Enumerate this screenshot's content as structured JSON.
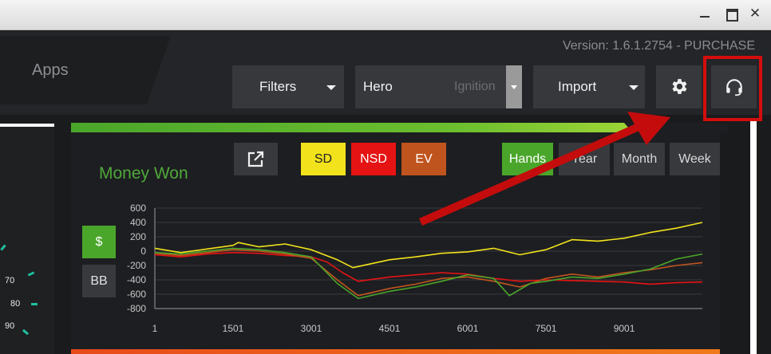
{
  "window": {
    "minimize_label": "",
    "maximize_label": "",
    "close_label": "✕"
  },
  "header": {
    "apps_tab": "Apps",
    "version": "Version: 1.6.1.2754 - PURCHASE",
    "filters_label": "Filters",
    "hero_label": "Hero",
    "hero_site": "Ignition",
    "import_label": "Import",
    "settings_icon": "gear-icon",
    "support_icon": "headset-icon"
  },
  "gauge": {
    "labels": [
      "70",
      "80",
      "90"
    ]
  },
  "panel": {
    "title": "Money Won",
    "share_icon": "external-link-icon",
    "sd_label": "SD",
    "nsd_label": "NSD",
    "ev_label": "EV",
    "hands_label": "Hands",
    "year_label": "Year",
    "month_label": "Month",
    "week_label": "Week",
    "dollar_label": "$",
    "bb_label": "BB"
  },
  "colors": {
    "accent_green": "#4aa62a",
    "sd_yellow": "#f2e21b",
    "nsd_red": "#e51313",
    "ev_orange": "#c0541e",
    "highlight_red": "#d40d0d"
  },
  "chart_data": {
    "type": "line",
    "title": "Money Won",
    "xlabel": "",
    "ylabel": "",
    "xlim": [
      1,
      10500
    ],
    "ylim": [
      -800,
      600
    ],
    "yticks": [
      "600",
      "400",
      "200",
      "0",
      "-200",
      "-400",
      "-600",
      "-800"
    ],
    "xticks": [
      "1",
      "1501",
      "3001",
      "4501",
      "6001",
      "7501",
      "9001"
    ],
    "xtick_values": [
      1,
      1501,
      3001,
      4501,
      6001,
      7501,
      9001
    ],
    "ytick_values": [
      600,
      400,
      200,
      0,
      -200,
      -400,
      -600,
      -800
    ],
    "grid": true,
    "series": [
      {
        "name": "SD",
        "color": "#f2e21b",
        "x": [
          1,
          500,
          1000,
          1500,
          1600,
          2000,
          2500,
          3000,
          3500,
          3800,
          4500,
          5000,
          5500,
          6000,
          6500,
          7000,
          7500,
          8000,
          8500,
          9000,
          9500,
          10000,
          10500
        ],
        "y": [
          40,
          -20,
          30,
          80,
          120,
          60,
          100,
          20,
          -120,
          -230,
          -120,
          -80,
          -30,
          -10,
          40,
          -50,
          20,
          160,
          140,
          180,
          260,
          320,
          400
        ]
      },
      {
        "name": "NSD",
        "color": "#e51313",
        "x": [
          1,
          500,
          1000,
          1500,
          2000,
          2500,
          3000,
          3300,
          3600,
          3900,
          4500,
          5000,
          5500,
          6000,
          6500,
          7000,
          7500,
          8000,
          8500,
          9000,
          9500,
          10000,
          10500
        ],
        "y": [
          -50,
          -80,
          -40,
          -20,
          -30,
          -60,
          -80,
          -150,
          -300,
          -420,
          -360,
          -330,
          -300,
          -320,
          -380,
          -420,
          -400,
          -410,
          -420,
          -430,
          -460,
          -440,
          -430
        ]
      },
      {
        "name": "EV",
        "color": "#c0541e",
        "x": [
          1,
          500,
          1000,
          1500,
          2000,
          2500,
          3000,
          3500,
          3900,
          4500,
          5000,
          5500,
          6000,
          6500,
          7000,
          7500,
          8000,
          8500,
          9000,
          9500,
          10000,
          10500
        ],
        "y": [
          -30,
          -60,
          -20,
          20,
          0,
          -40,
          -100,
          -400,
          -620,
          -520,
          -460,
          -380,
          -360,
          -420,
          -500,
          -380,
          -320,
          -360,
          -300,
          -260,
          -200,
          -160
        ]
      },
      {
        "name": "Hands",
        "color": "#4aa62a",
        "x": [
          1,
          500,
          1000,
          1500,
          2000,
          2500,
          3000,
          3500,
          3900,
          4500,
          5000,
          5500,
          6000,
          6500,
          6800,
          7200,
          7500,
          8000,
          8500,
          9000,
          9500,
          10000,
          10500
        ],
        "y": [
          -20,
          -40,
          0,
          40,
          20,
          -20,
          -80,
          -450,
          -660,
          -560,
          -500,
          -420,
          -330,
          -380,
          -620,
          -450,
          -420,
          -360,
          -380,
          -320,
          -250,
          -110,
          -40
        ]
      }
    ]
  }
}
